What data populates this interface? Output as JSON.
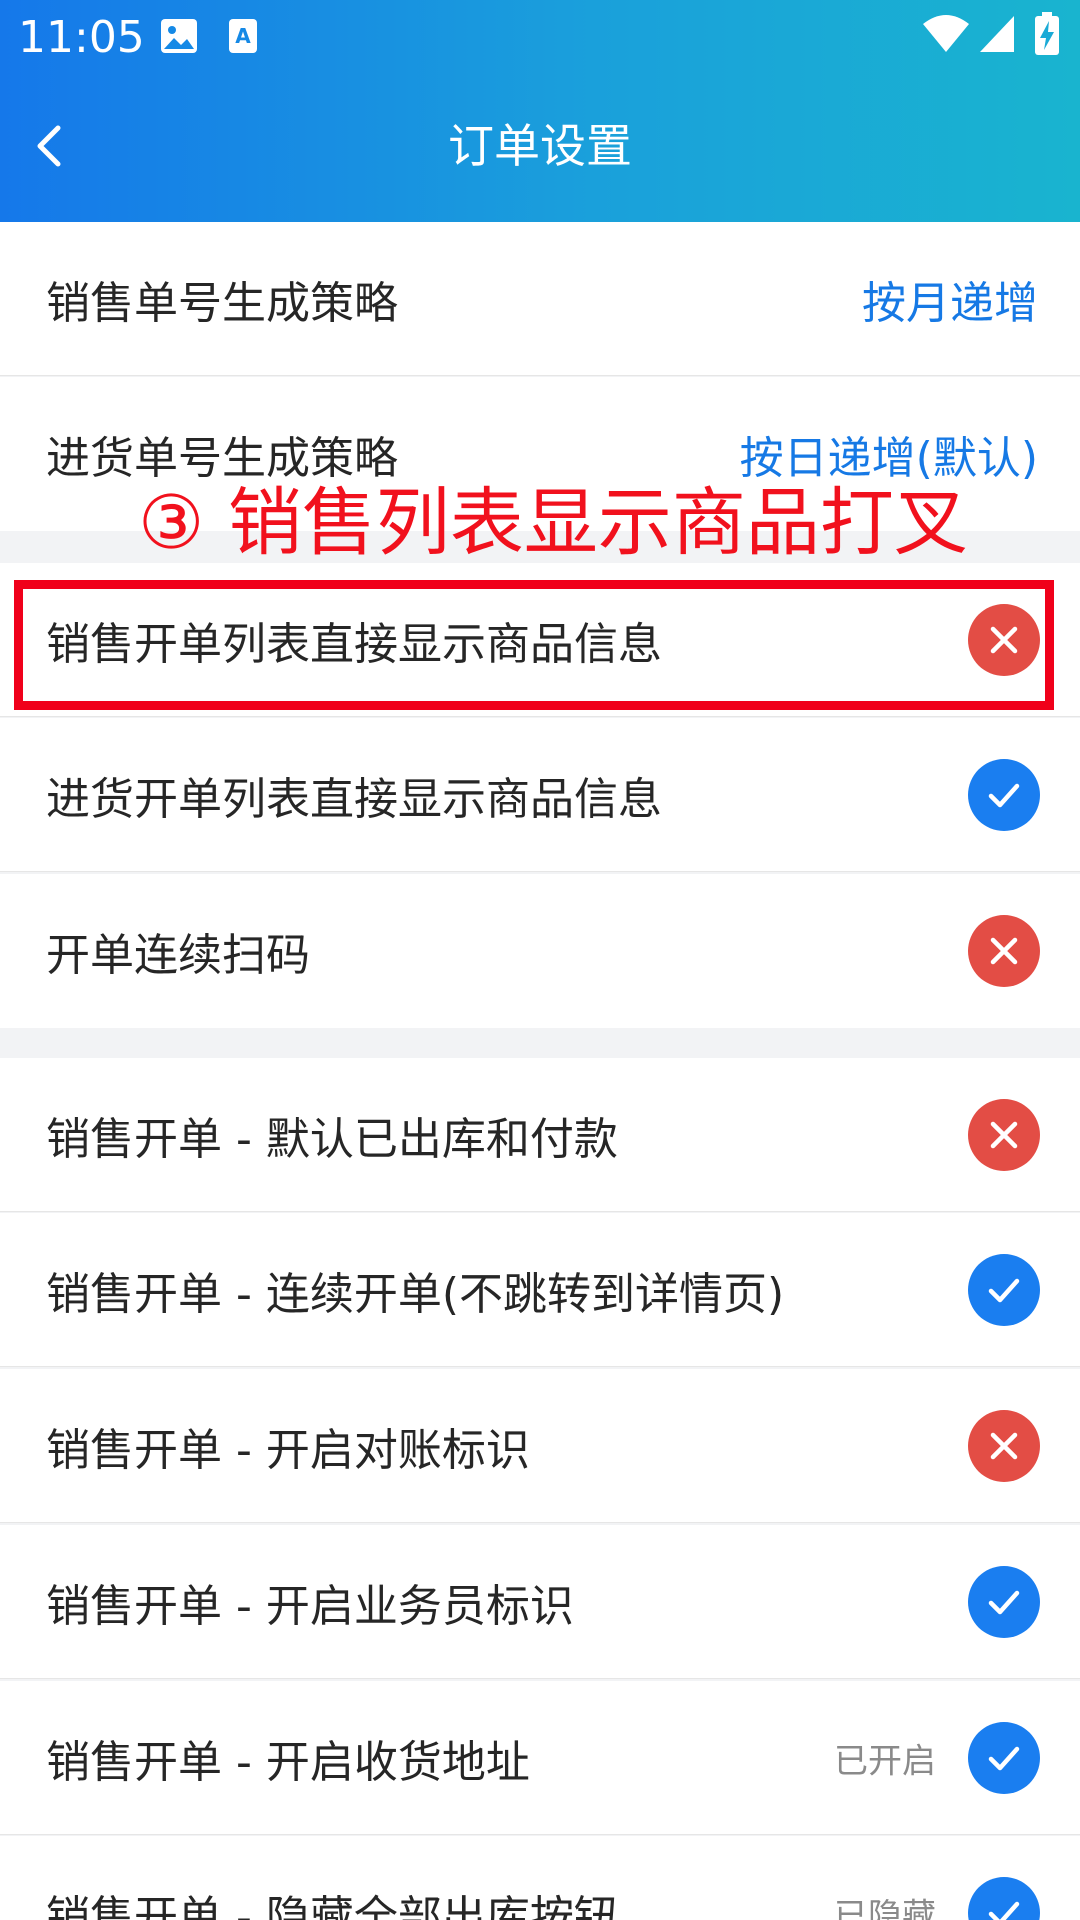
{
  "status_bar": {
    "time": "11:05",
    "icons": [
      "image-icon",
      "a-notification-icon",
      "wifi-icon",
      "signal-icon",
      "battery-charging-icon"
    ]
  },
  "header": {
    "title": "订单设置",
    "back_icon": "chevron-left-icon"
  },
  "colors": {
    "header_start": "#1578ea",
    "header_end": "#19b4cf",
    "accent_blue": "#1679e5",
    "toggle_on": "#1a7ef0",
    "toggle_off": "#e34d45",
    "annotation_red": "#f0001a"
  },
  "settings": {
    "sales_number_strategy": {
      "label": "销售单号生成策略",
      "value": "按月递增"
    },
    "purchase_number_strategy": {
      "label": "进货单号生成策略",
      "value": "按日递增(默认)"
    },
    "toggles": [
      {
        "label": "销售开单列表直接显示商品信息",
        "state": "off",
        "icon": "close-icon"
      },
      {
        "label": "进货开单列表直接显示商品信息",
        "state": "on",
        "icon": "check-icon"
      },
      {
        "label": "开单连续扫码",
        "state": "off",
        "icon": "close-icon"
      },
      {
        "label": "销售开单 - 默认已出库和付款",
        "state": "off",
        "icon": "close-icon"
      },
      {
        "label": "销售开单 - 连续开单(不跳转到详情页)",
        "state": "on",
        "icon": "check-icon"
      },
      {
        "label": "销售开单 - 开启对账标识",
        "state": "off",
        "icon": "close-icon"
      },
      {
        "label": "销售开单 - 开启业务员标识",
        "state": "on",
        "icon": "check-icon"
      },
      {
        "label": "销售开单 - 开启收货地址",
        "state": "on",
        "icon": "check-icon",
        "note": "已开启"
      },
      {
        "label": "销售开单 - 隐藏全部出库按钮",
        "state": "on",
        "icon": "check-icon",
        "note": "已隐藏"
      }
    ]
  },
  "annotation": {
    "text": "③ 销售列表显示商品打叉"
  }
}
